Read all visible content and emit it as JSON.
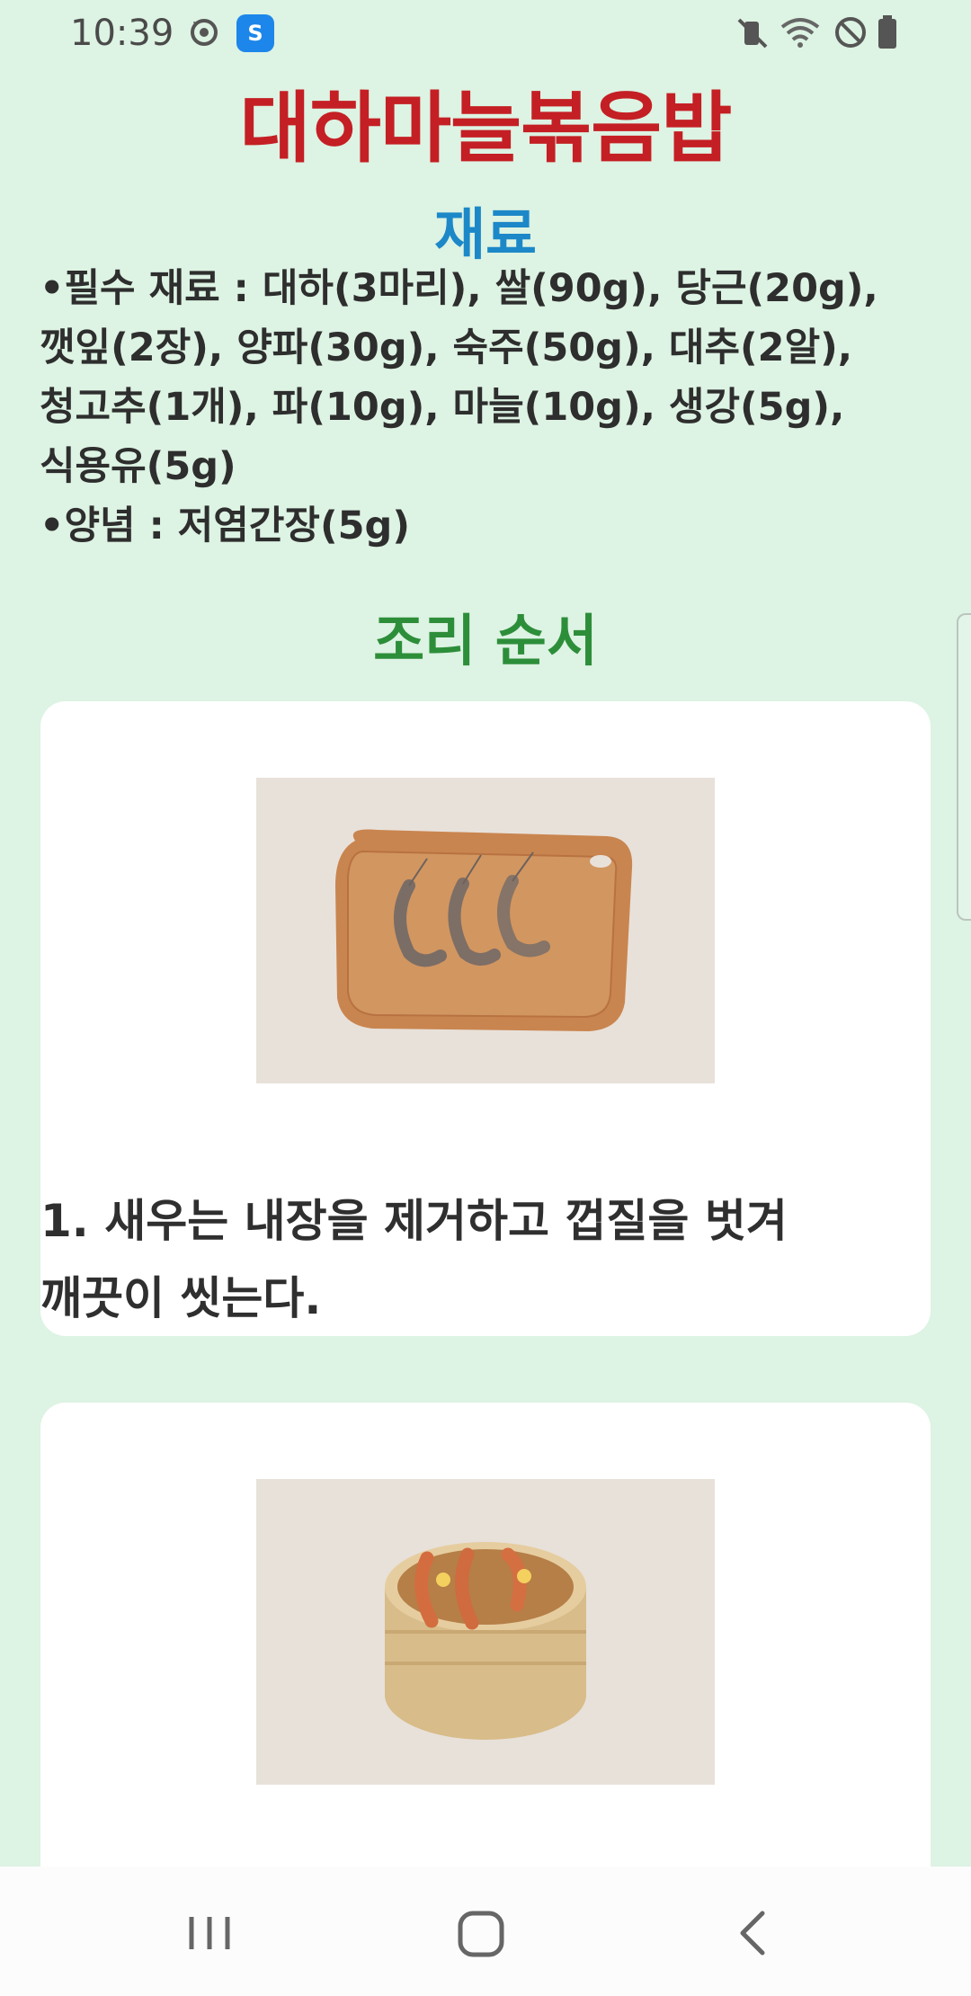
{
  "status_bar": {
    "time": "10:39",
    "left_icons": [
      "sync-icon",
      "app-s-icon"
    ],
    "right_icons": [
      "vibrate-mute-icon",
      "wifi-icon",
      "do-not-disturb-icon",
      "battery-icon"
    ],
    "app_badge_letter": "S"
  },
  "page": {
    "title": "대하마늘볶음밥",
    "ingredients_heading": "재료",
    "ingredients_lines": [
      "•필수 재료 : 대하(3마리), 쌀(90g), 당근(20g),",
      "깻잎(2장), 양파(30g), 숙주(50g), 대추(2알),",
      "청고추(1개), 파(10g), 마늘(10g), 생강(5g),",
      "식용유(5g)",
      "•양념 : 저염간장(5g)"
    ],
    "steps_heading": "조리 순서",
    "steps": [
      {
        "text": "1. 새우는 내장을 제거하고 껍질을 벗겨\n깨끗이 씻는다.",
        "image": "shrimp-on-cutting-board"
      },
      {
        "text": "",
        "image": "shrimp-in-bamboo-steamer"
      }
    ]
  },
  "colors": {
    "background": "#ddf3e3",
    "title": "#c41f24",
    "ingredients_heading": "#1c88c8",
    "steps_heading": "#2d8e3a",
    "card": "#ffffff"
  },
  "nav_bar": {
    "buttons": [
      "recent-apps-icon",
      "home-icon",
      "back-icon"
    ]
  }
}
